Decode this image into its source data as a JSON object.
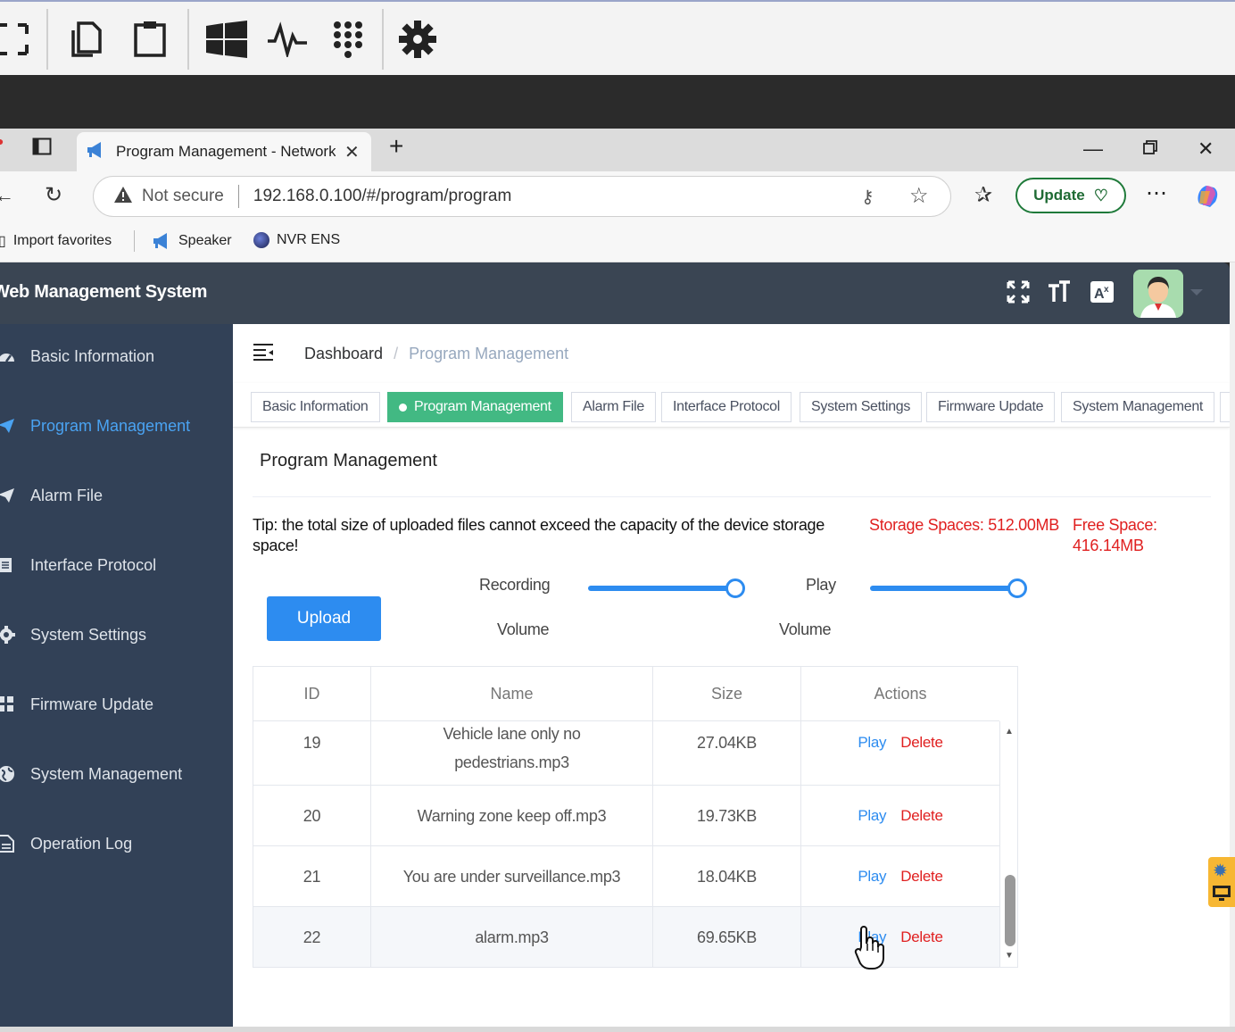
{
  "browser": {
    "tab_title": "Program Management - Network",
    "security_label": "Not secure",
    "url": "192.168.0.100/#/program/program",
    "update_label": "Update",
    "favorites": [
      "Import favorites",
      "Speaker",
      "NVR ENS"
    ]
  },
  "app": {
    "title": "Web Management System"
  },
  "sidebar": {
    "items": [
      {
        "label": "Basic Information",
        "icon": "dashboard-icon"
      },
      {
        "label": "Program Management",
        "icon": "send-icon"
      },
      {
        "label": "Alarm File",
        "icon": "send-icon"
      },
      {
        "label": "Interface Protocol",
        "icon": "document-icon"
      },
      {
        "label": "System Settings",
        "icon": "gear-icon"
      },
      {
        "label": "Firmware Update",
        "icon": "grid-icon"
      },
      {
        "label": "System Management",
        "icon": "globe-icon"
      },
      {
        "label": "Operation Log",
        "icon": "file-icon"
      }
    ],
    "active_color": "#4aa3f2"
  },
  "breadcrumb": {
    "home": "Dashboard",
    "separator": "/",
    "current": "Program Management"
  },
  "tags": [
    "Basic Information",
    "Program Management",
    "Alarm File",
    "Interface Protocol",
    "System Settings",
    "Firmware Update",
    "System Management"
  ],
  "card": {
    "title": "Program Management",
    "tip": "Tip: the total size of uploaded files cannot exceed the capacity of the device storage space!",
    "storage": "Storage Spaces: 512.00MB",
    "free": "Free Space: 416.14MB",
    "upload_label": "Upload",
    "recording_label_1": "Recording",
    "recording_label_2": "Volume",
    "play_label_1": "Play",
    "play_label_2": "Volume",
    "recording_volume": 100,
    "play_volume": 100
  },
  "table": {
    "headers": [
      "ID",
      "Name",
      "Size",
      "Actions"
    ],
    "rows": [
      {
        "id": "19",
        "name": "Vehicle lane only no pedestrians.mp3",
        "size": "27.04KB"
      },
      {
        "id": "20",
        "name": "Warning zone keep off.mp3",
        "size": "19.73KB"
      },
      {
        "id": "21",
        "name": "You are under surveillance.mp3",
        "size": "18.04KB"
      },
      {
        "id": "22",
        "name": "alarm.mp3",
        "size": "69.65KB"
      }
    ],
    "play_label": "Play",
    "delete_label": "Delete"
  },
  "colors": {
    "header_bg": "#3a4553",
    "sidebar_bg": "#324157",
    "accent": "#2d8cf0",
    "tag_active": "#42b983",
    "danger": "#e02020"
  }
}
